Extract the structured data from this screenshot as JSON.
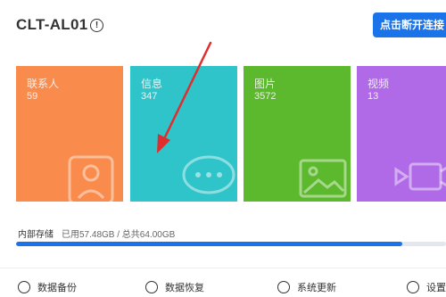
{
  "header": {
    "device_name": "CLT-AL01",
    "info_icon": "!",
    "connect_button": "点击断开连接"
  },
  "cards": [
    {
      "label": "联系人",
      "count": "59",
      "color": "#f98b4c",
      "icon": "contact-person-icon"
    },
    {
      "label": "信息",
      "count": "347",
      "color": "#2ec4c9",
      "icon": "chat-bubble-icon"
    },
    {
      "label": "图片",
      "count": "3572",
      "color": "#5cb82d",
      "icon": "picture-icon"
    },
    {
      "label": "视频",
      "count": "13",
      "color": "#b06ae8",
      "icon": "video-camera-icon"
    }
  ],
  "storage": {
    "label": "内部存储",
    "value": "已用57.48GB / 总共64.00GB",
    "used_fraction": 0.898
  },
  "actions": [
    {
      "label": "数据备份",
      "icon": "backup-clock-icon"
    },
    {
      "label": "数据恢复",
      "icon": "restore-search-icon"
    },
    {
      "label": "系统更新",
      "icon": "update-arrow-icon"
    },
    {
      "label": "设置",
      "icon": "gear-icon"
    }
  ]
}
